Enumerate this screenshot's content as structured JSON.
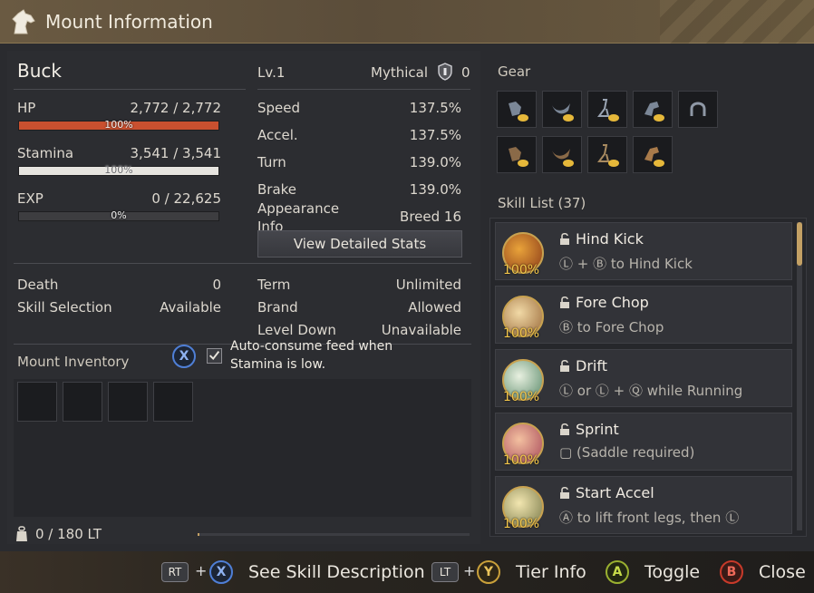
{
  "window": {
    "title": "Mount Information"
  },
  "mount": {
    "name": "Buck",
    "level": "Lv.1",
    "grade": "Mythical",
    "grade_count": "0",
    "hp": {
      "label": "HP",
      "value": "2,772 / 2,772",
      "pct_label": "100%",
      "fill": 1.0
    },
    "stamina": {
      "label": "Stamina",
      "value": "3,541 / 3,541",
      "pct_label": "100%",
      "fill": 1.0
    },
    "exp": {
      "label": "EXP",
      "value": "0 / 22,625",
      "pct_label": "0%",
      "fill": 0.0
    }
  },
  "stats": {
    "speed": {
      "label": "Speed",
      "value": "137.5%"
    },
    "accel": {
      "label": "Accel.",
      "value": "137.5%"
    },
    "turn": {
      "label": "Turn",
      "value": "139.0%"
    },
    "brake": {
      "label": "Brake",
      "value": "139.0%"
    },
    "appearance": {
      "label": "Appearance Info",
      "value": "Breed 16"
    },
    "view_button": "View Detailed Stats"
  },
  "details": {
    "death": {
      "label": "Death",
      "value": "0"
    },
    "skill_selection": {
      "label": "Skill Selection",
      "value": "Available"
    },
    "term": {
      "label": "Term",
      "value": "Unlimited"
    },
    "brand": {
      "label": "Brand",
      "value": "Allowed"
    },
    "level_down": {
      "label": "Level Down",
      "value": "Unavailable"
    }
  },
  "inventory": {
    "title": "Mount Inventory",
    "auto_key": "X",
    "auto_label_line1": "Auto-consume feed when",
    "auto_label_line2": "Stamina is low.",
    "auto_checked": true,
    "weight": "0 / 180 LT"
  },
  "gear": {
    "title": "Gear"
  },
  "skills": {
    "title": "Skill List (37)",
    "items": [
      {
        "name": "Hind Kick",
        "level": "100%",
        "desc": "Ⓛ + Ⓑ to Hind Kick"
      },
      {
        "name": "Fore Chop",
        "level": "100%",
        "desc": "Ⓑ to Fore Chop"
      },
      {
        "name": "Drift",
        "level": "100%",
        "desc": "Ⓛ or Ⓛ + Ⓠ while Running"
      },
      {
        "name": "Sprint",
        "level": "100%",
        "desc": "▢ (Saddle required)"
      },
      {
        "name": "Start Accel",
        "level": "100%",
        "desc": "Ⓐ to lift front legs, then Ⓛ"
      }
    ]
  },
  "bottom": {
    "rt": "RT",
    "x": "X",
    "see_skill": "See Skill Description",
    "lt": "LT",
    "y": "Y",
    "tier_info": "Tier Info",
    "a": "A",
    "toggle": "Toggle",
    "b": "B",
    "close": "Close",
    "plus": "+"
  },
  "colors": {
    "hp_bar": "#c9502f",
    "stamina_bar": "#e6e4df",
    "accent_gold": "#c3a064",
    "skill_level": "#f3c64a"
  }
}
